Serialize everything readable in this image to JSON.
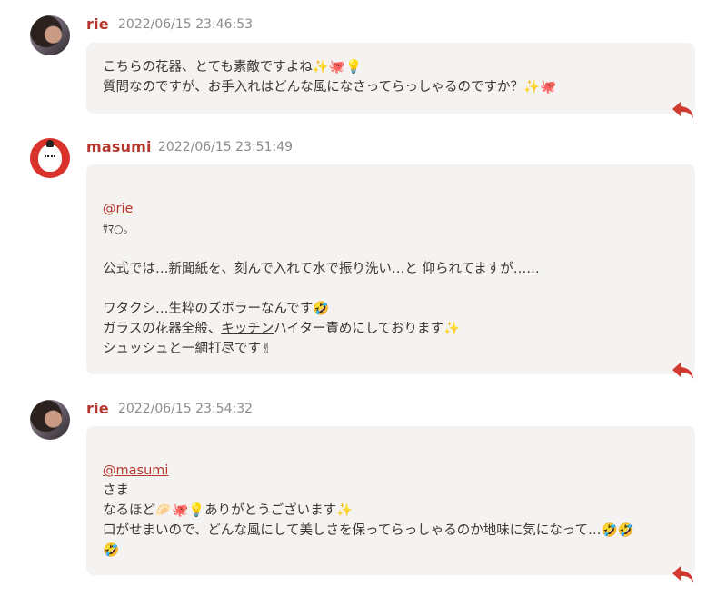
{
  "comments": [
    {
      "author": "rie",
      "timestamp": "2022/06/15 23:46:53",
      "lines": [
        "こちらの花器、とても素敵ですよね✨🐙💡",
        "質問なのですが、お手入れはどんな風になさってらっしゃるのですか？✨🐙"
      ]
    },
    {
      "author": "masumi",
      "timestamp": "2022/06/15 23:51:49",
      "mention": "@rie",
      "lines": [
        "ｻﾏ○｡",
        "",
        "公式では…新聞紙を、刻んで入れて水で振り洗い…と 仰られてますが……",
        "",
        "ワタクシ…生粋のズボラーなんです🤣",
        "ガラスの花器全般、",
        "ハイター責めにしております✨",
        "シュッシュと一網打尽です✌"
      ],
      "underlined_word": "キッチン"
    },
    {
      "author": "rie",
      "timestamp": "2022/06/15 23:54:32",
      "mention": "@masumi",
      "lines": [
        "さま",
        "なるほど🥟🐙💡ありがとうございます✨",
        "口がせまいので、どんな風にして美しさを保ってらっしゃるのか地味に気になって…🤣🤣",
        "🤣"
      ]
    }
  ],
  "colors": {
    "accent": "#b5362d",
    "bubble_bg": "#f4f3f1",
    "timestamp": "#8c8c8c",
    "reply_icon": "#d13b31"
  },
  "icons": {
    "reply": "reply-arrow-icon"
  }
}
